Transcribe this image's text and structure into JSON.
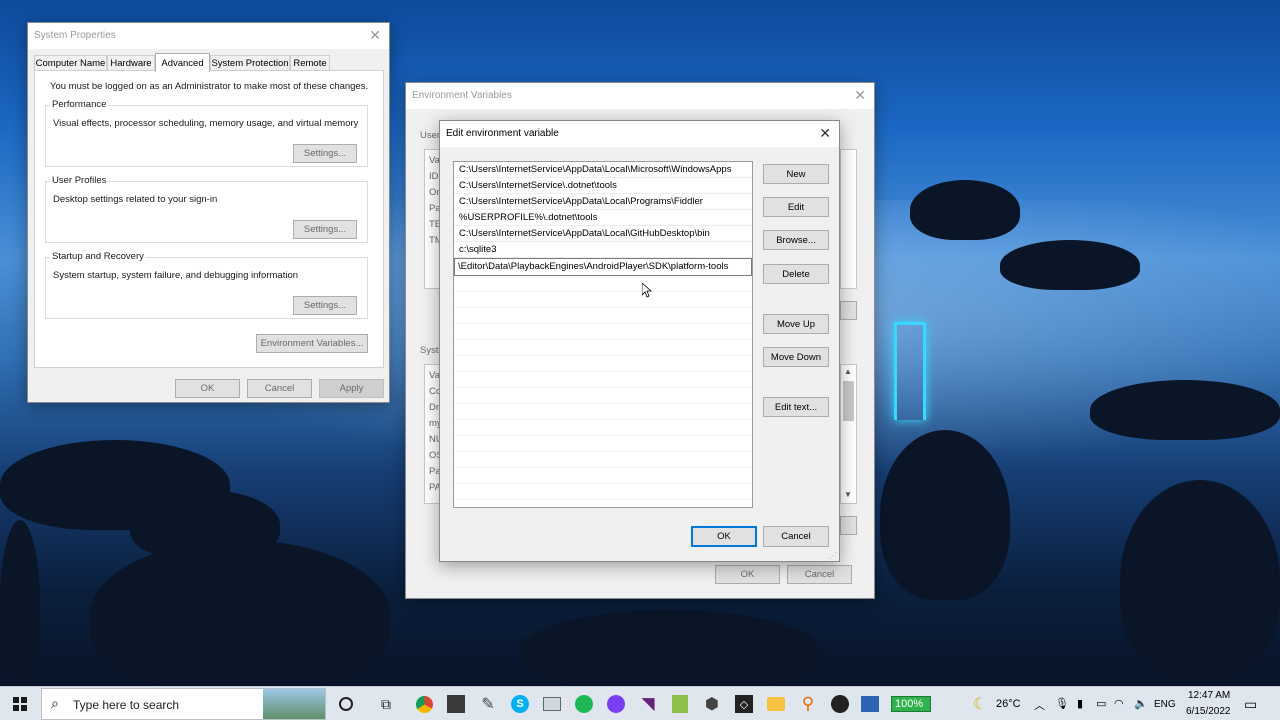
{
  "system_properties": {
    "title": "System Properties",
    "tabs": [
      "Computer Name",
      "Hardware",
      "Advanced",
      "System Protection",
      "Remote"
    ],
    "active_tab": "Advanced",
    "admin_note": "You must be logged on as an Administrator to make most of these changes.",
    "performance": {
      "label": "Performance",
      "desc": "Visual effects, processor scheduling, memory usage, and virtual memory",
      "button": "Settings..."
    },
    "user_profiles": {
      "label": "User Profiles",
      "desc": "Desktop settings related to your sign-in",
      "button": "Settings..."
    },
    "startup": {
      "label": "Startup and Recovery",
      "desc": "System startup, system failure, and debugging information",
      "button": "Settings..."
    },
    "env_button": "Environment Variables...",
    "ok": "OK",
    "cancel": "Cancel",
    "apply": "Apply"
  },
  "env_vars": {
    "title": "Environment Variables",
    "user_label": "User",
    "system_label": "Syste",
    "user_rows": [
      "Va",
      "ID",
      "On",
      "Pa",
      "TE",
      "TM"
    ],
    "system_rows": [
      "Va",
      "Co",
      "Dr",
      "my",
      "NU",
      "OS",
      "Pa",
      "PA"
    ],
    "ok": "OK",
    "cancel": "Cancel"
  },
  "edit_env": {
    "title": "Edit environment variable",
    "entries": [
      "C:\\Users\\InternetService\\AppData\\Local\\Microsoft\\WindowsApps",
      "C:\\Users\\InternetService\\.dotnet\\tools",
      "C:\\Users\\InternetService\\AppData\\Local\\Programs\\Fiddler",
      "%USERPROFILE%\\.dotnet\\tools",
      "C:\\Users\\InternetService\\AppData\\Local\\GitHubDesktop\\bin",
      "c:\\sqlite3"
    ],
    "editing_value": "\\Editor\\Data\\PlaybackEngines\\AndroidPlayer\\SDK\\platform-tools",
    "buttons": {
      "new": "New",
      "edit": "Edit",
      "browse": "Browse...",
      "delete": "Delete",
      "move_up": "Move Up",
      "move_down": "Move Down",
      "edit_text": "Edit text..."
    },
    "ok": "OK",
    "cancel": "Cancel"
  },
  "taskbar": {
    "search_placeholder": "Type here to search",
    "battery": "100%",
    "weather": "26°C",
    "language": "ENG",
    "time": "12:47 AM",
    "date": "6/15/2022"
  },
  "colors": {
    "accent": "#0078d7",
    "battery_green": "#2fb24c"
  }
}
